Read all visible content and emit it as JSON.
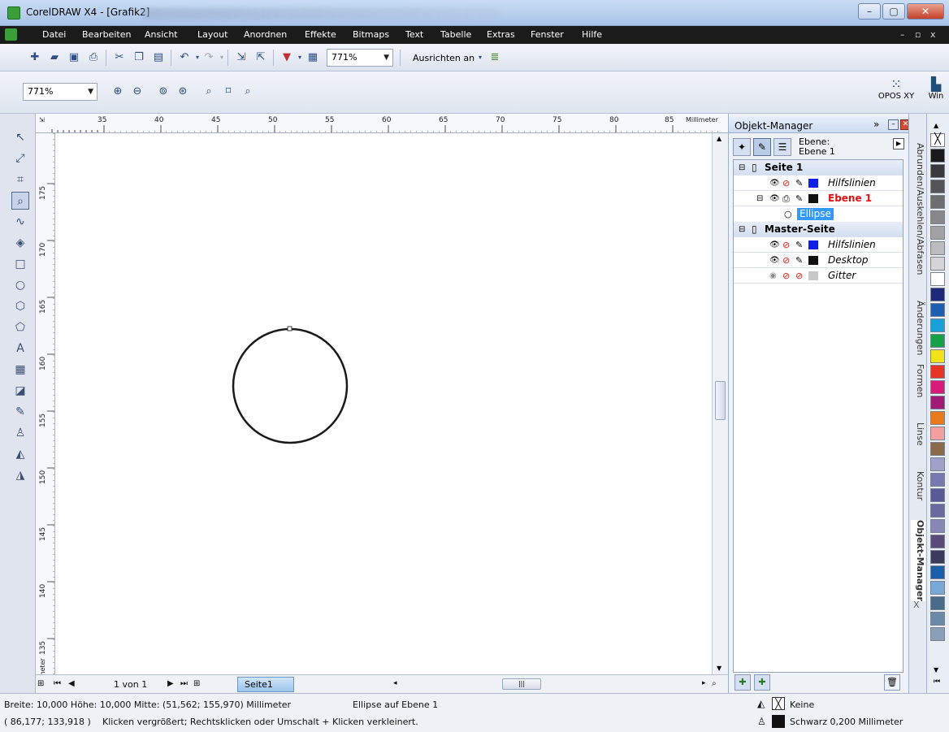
{
  "window": {
    "title": "CorelDRAW X4 - [Grafik2]"
  },
  "menu": [
    "Datei",
    "Bearbeiten",
    "Ansicht",
    "Layout",
    "Anordnen",
    "Effekte",
    "Bitmaps",
    "Text",
    "Tabelle",
    "Extras",
    "Fenster",
    "Hilfe"
  ],
  "toolbar": {
    "zoom_value": "771%",
    "align_label": "Ausrichten an",
    "zoom_value2": "771%"
  },
  "right_tools": {
    "opos": "OPOS XY",
    "win": "Win"
  },
  "ruler": {
    "unit": "Millimeter",
    "top_labels": [
      "35",
      "40",
      "45",
      "50",
      "55",
      "60",
      "65",
      "70",
      "75",
      "80",
      "85"
    ],
    "left_labels": [
      "175",
      "170",
      "165",
      "160",
      "155",
      "150",
      "145",
      "140",
      "135"
    ],
    "left_unit": "Millimeter"
  },
  "page_nav": {
    "counter": "1 von 1",
    "page_tab": "Seite1"
  },
  "object_manager": {
    "title": "Objekt-Manager",
    "layer_label": "Ebene:",
    "layer_value": "Ebene 1",
    "rows": {
      "seite1": "Seite 1",
      "hilfslinien1": "Hilfslinien",
      "ebene1": "Ebene 1",
      "ellipse": "Ellipse",
      "master": "Master-Seite",
      "hilfslinien2": "Hilfslinien",
      "desktop": "Desktop",
      "gitter": "Gitter"
    }
  },
  "side_tabs": [
    "Abrunden/Auskehlen/Abfasen",
    "Änderungen",
    "Formen",
    "Linse",
    "Kontur",
    "Objekt-Manager"
  ],
  "palette_colors": [
    "#1a1a1a",
    "#3a3a3a",
    "#555555",
    "#6e6e6e",
    "#888888",
    "#a2a2a2",
    "#bcbcbc",
    "#d5d5d5",
    "#ffffff",
    "#1e2a78",
    "#1c5fb0",
    "#1aa0d8",
    "#18a048",
    "#f2e21a",
    "#e83424",
    "#d81a78",
    "#a01a78",
    "#e87a1a",
    "#f4a0a0",
    "#8a6a4a",
    "#a0a0c8",
    "#7878b0",
    "#5a5a98",
    "#6a6aa0",
    "#8888b8",
    "#5a4a7a",
    "#3a3a5a",
    "#1c5fa8",
    "#78a8d8",
    "#4a6a8a",
    "#6a8aa8",
    "#8aa0b8"
  ],
  "status": {
    "dims": "Breite: 10,000  Höhe: 10,000  Mitte: (51,562; 155,970)  Millimeter",
    "object": "Ellipse auf Ebene 1",
    "coords": "( 86,177; 133,918 )",
    "hint": "Klicken vergrößert; Rechtsklicken oder Umschalt + Klicken verkleinert.",
    "fill": "Keine",
    "outline": "Schwarz  0,200 Millimeter"
  },
  "colors": {
    "selection": "#3399ff",
    "layer_red": "#e01010"
  }
}
